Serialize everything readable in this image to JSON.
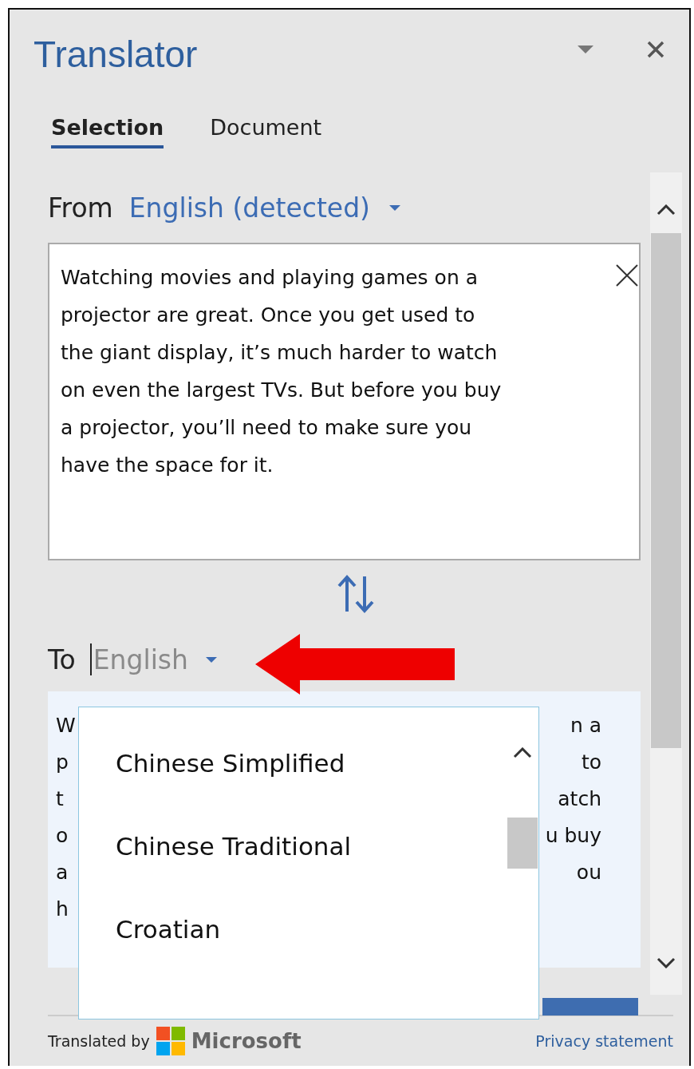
{
  "pane": {
    "title": "Translator"
  },
  "tabs": [
    {
      "label": "Selection",
      "selected": true
    },
    {
      "label": "Document",
      "selected": false
    }
  ],
  "from": {
    "label": "From",
    "language": "English (detected)"
  },
  "source_text": "Watching movies and playing games on a\nprojector are great. Once you get used to\nthe giant display, it’s much harder to watch\non even the largest TVs. But before you buy\na projector, you’ll need to make sure you\nhave the space for it.",
  "to": {
    "label": "To",
    "language": "English"
  },
  "output_fragments": [
    {
      "left": "W",
      "right": "n a"
    },
    {
      "left": "p",
      "right": "to"
    },
    {
      "left": "t",
      "right": "atch"
    },
    {
      "left": "o",
      "right": "u buy"
    },
    {
      "left": "a",
      "right": "ou"
    },
    {
      "left": "h"
    }
  ],
  "language_list": [
    {
      "label": "Chinese Simplified"
    },
    {
      "label": "Chinese Traditional"
    },
    {
      "label": "Croatian"
    }
  ],
  "footer": {
    "credit": "Translated by",
    "brand": "Microsoft",
    "link": "Privacy statement"
  }
}
